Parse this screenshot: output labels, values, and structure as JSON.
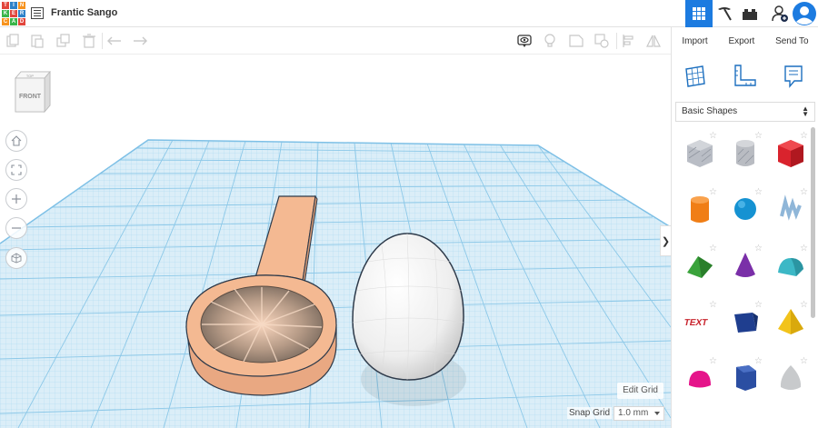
{
  "app": {
    "logo_letters": [
      "T",
      "I",
      "N",
      "K",
      "E",
      "R",
      "C",
      "A",
      "D"
    ],
    "logo_colors": [
      "#e2463c",
      "#2e82c9",
      "#f7931e",
      "#3ab54a",
      "#e2463c",
      "#2e82c9",
      "#f7931e",
      "#3ab54a",
      "#e2463c"
    ],
    "project_title": "Frantic Sango"
  },
  "header": {
    "active_color": "#1c7be0",
    "buttons": [
      "grid-view-icon",
      "pickaxe-icon",
      "bricks-icon",
      "add-user-icon",
      "profile-avatar"
    ]
  },
  "toolbar": {
    "left_icons": [
      "copy-icon",
      "paste-icon",
      "duplicate-icon",
      "delete-icon",
      "undo-icon",
      "redo-icon"
    ],
    "right_icons": [
      "show-all-icon",
      "light-bulb-icon",
      "note-icon",
      "group-icon",
      "align-icon",
      "mirror-icon"
    ]
  },
  "panel": {
    "import_label": "Import",
    "export_label": "Export",
    "send_to_label": "Send To",
    "view_icons": [
      "workplane-icon",
      "ruler-icon",
      "notes-icon"
    ],
    "shapes_category": "Basic Shapes",
    "shapes": [
      {
        "name": "box-hole",
        "color": "#a9aeb8"
      },
      {
        "name": "cylinder-hole",
        "color": "#b9bcc2"
      },
      {
        "name": "box",
        "color": "#d9232d"
      },
      {
        "name": "cylinder",
        "color": "#f07e16"
      },
      {
        "name": "sphere",
        "color": "#1592d2"
      },
      {
        "name": "scribble",
        "color": "#8fb6d8"
      },
      {
        "name": "roof",
        "color": "#3aa33b"
      },
      {
        "name": "cone",
        "color": "#7a2fa8"
      },
      {
        "name": "round-roof",
        "color": "#3cb8c6"
      },
      {
        "name": "text",
        "color": "#c8232c"
      },
      {
        "name": "wedge",
        "color": "#1f3e8f"
      },
      {
        "name": "pyramid",
        "color": "#f2c31b"
      },
      {
        "name": "half-sphere",
        "color": "#e5148a"
      },
      {
        "name": "polygon",
        "color": "#2b4ea2"
      },
      {
        "name": "paraboloid",
        "color": "#c8cacc"
      }
    ],
    "text_shape_label": "TEXT"
  },
  "viewcube": {
    "face_label": "FRONT",
    "top_label": "TOP"
  },
  "nav": [
    "home-view-icon",
    "fit-view-icon",
    "zoom-in-icon",
    "zoom-out-icon",
    "perspective-icon"
  ],
  "workplane": {
    "edit_grid_label": "Edit Grid",
    "snap_grid_label": "Snap Grid",
    "snap_grid_value": "1.0 mm",
    "grid_color": "#8cc8e8",
    "plane_color": "#dbeef8",
    "objects": [
      {
        "name": "magnifier-handle",
        "color": "#f4b992"
      },
      {
        "name": "egg",
        "color": "#f2f2f2"
      }
    ]
  },
  "collapse_glyph": "❯"
}
